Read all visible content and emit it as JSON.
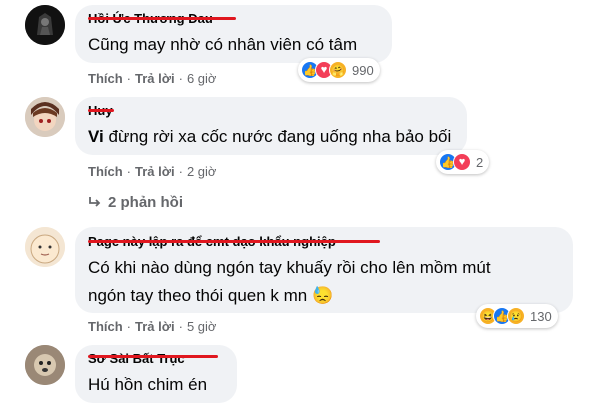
{
  "comments": [
    {
      "author": "Hồi Ức Thương Đau",
      "text": "Cũng may nhờ có nhân viên có tâm",
      "actions": {
        "like": "Thích",
        "reply": "Trả lời",
        "time": "6 giờ"
      },
      "reaction_count": "990",
      "reactions": [
        "like-icon",
        "love-icon",
        "care-icon"
      ]
    },
    {
      "author": "Huy",
      "mention": "Vi",
      "text": " đừng rời xa cốc nước đang uống nha bảo bối",
      "actions": {
        "like": "Thích",
        "reply": "Trả lời",
        "time": "2 giờ"
      },
      "reaction_count": "2",
      "reactions": [
        "like-icon",
        "love-icon"
      ],
      "replies": "2 phản hồi"
    },
    {
      "author": "Page này lập ra để cmt dạo khẩu nghiệp",
      "text_line1": "Có khi nào dùng ngón tay khuấy rồi cho lên mồm mút",
      "text_line2": "ngón tay theo thói quen k mn",
      "emoji": "😓",
      "actions": {
        "like": "Thích",
        "reply": "Trả lời",
        "time": "5 giờ"
      },
      "reaction_count": "130",
      "reactions": [
        "haha-icon",
        "like-icon",
        "sad-icon"
      ]
    },
    {
      "author": "Sơ Sài Bất Trục",
      "text": "Hú hồn chim én"
    }
  ]
}
